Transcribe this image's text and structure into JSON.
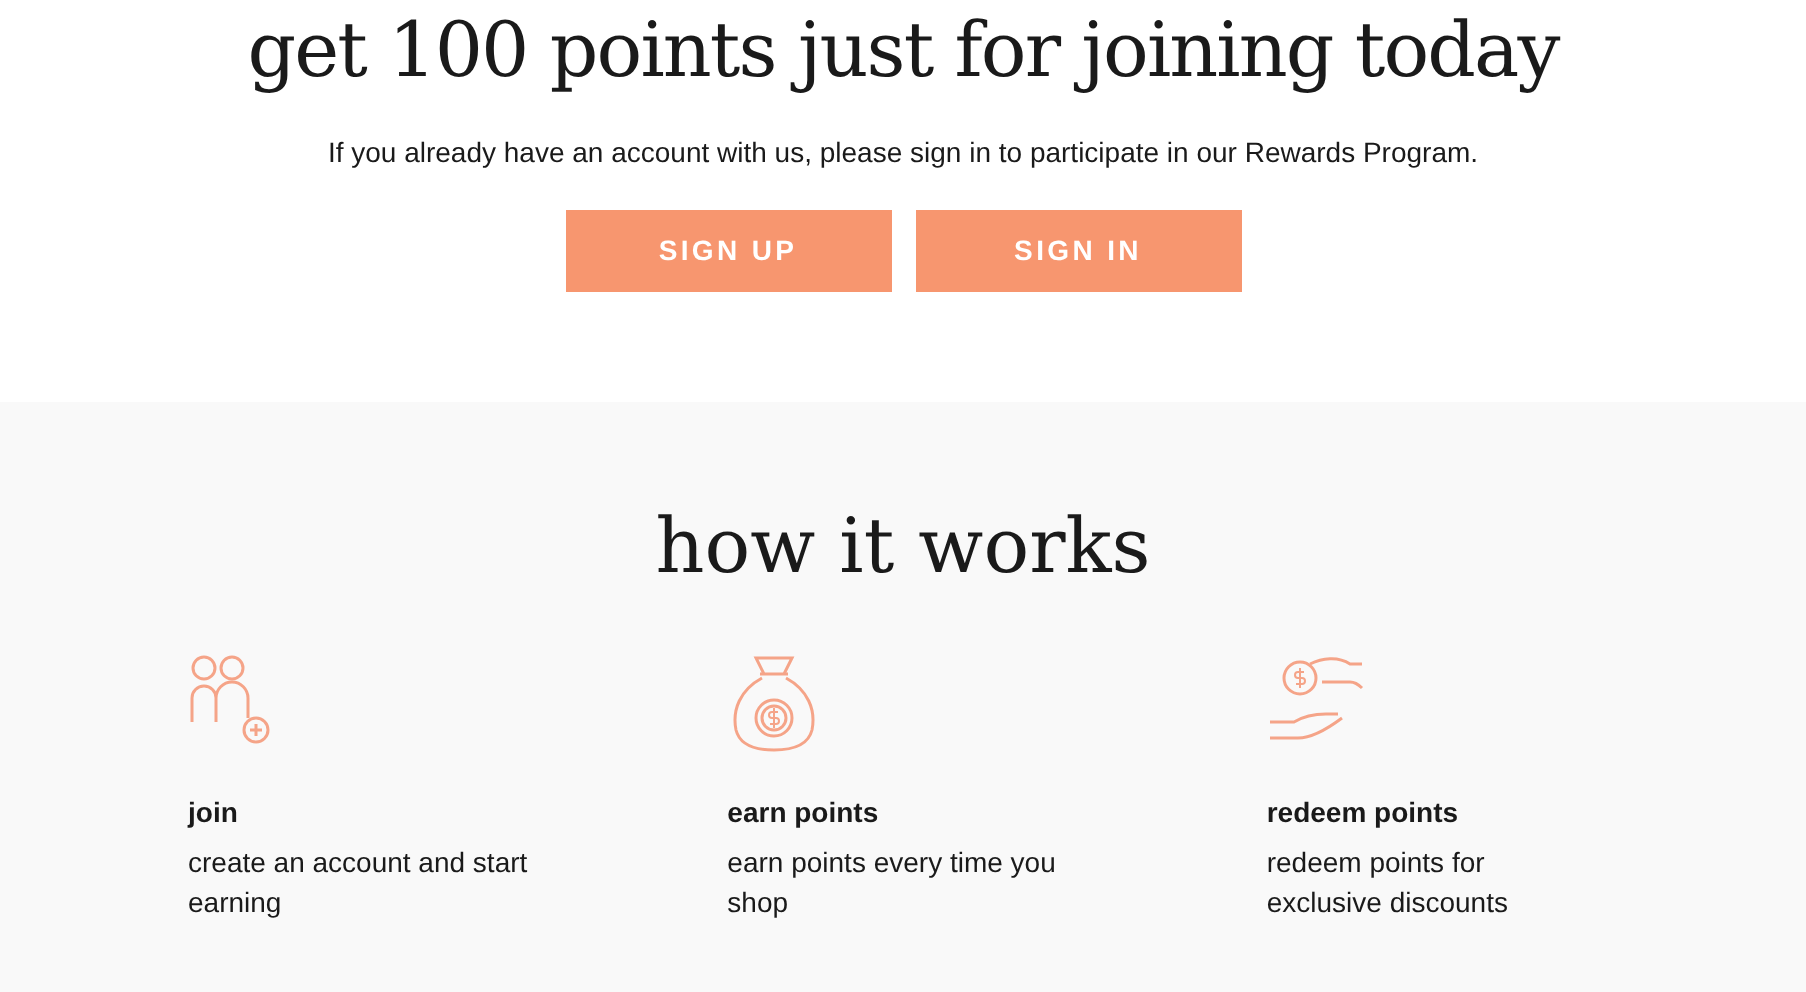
{
  "hero": {
    "title": "get 100 points just for joining today",
    "subtitle": "If you already have an account with us, please sign in to participate in our Rewards Program.",
    "buttons": [
      "SIGN UP",
      "SIGN IN"
    ]
  },
  "how_it_works": {
    "title": "how it works",
    "steps": [
      {
        "kind": "join",
        "title": "join",
        "description": "create an account and start earning"
      },
      {
        "kind": "earn",
        "title": "earn points",
        "description": "earn points every time you shop"
      },
      {
        "kind": "redeem",
        "title": "redeem points",
        "description": "redeem points for exclusive discounts"
      }
    ]
  }
}
